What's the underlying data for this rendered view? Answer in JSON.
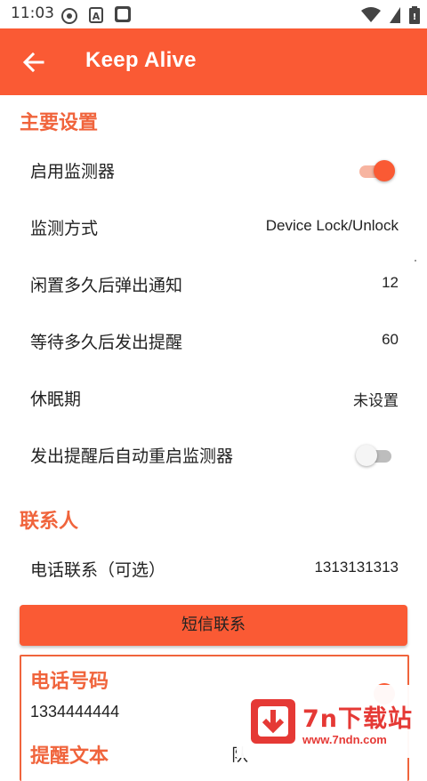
{
  "status_bar": {
    "time": "11:03",
    "icons": [
      "sync-icon",
      "text-a-icon",
      "white-square-icon",
      "wifi-icon",
      "battery-icon"
    ]
  },
  "app_bar": {
    "title": "Keep Alive",
    "background": "#FA5A34",
    "back_icon": "arrow-left-icon"
  },
  "main_section": {
    "title": "主要设置",
    "items": [
      {
        "label": "启用监测器",
        "type": "toggle",
        "on": true
      },
      {
        "label": "监测方式",
        "type": "value",
        "value": "Device Lock/Unlock"
      },
      {
        "label": "闲置多久后弹出通知",
        "type": "value",
        "value": "12"
      },
      {
        "label": "等待多久后发出提醒",
        "type": "value",
        "value": "60"
      },
      {
        "label": "休眠期",
        "type": "value",
        "value": "未设置"
      },
      {
        "label": "发出提醒后自动重启监测器",
        "type": "toggle",
        "on": false
      }
    ]
  },
  "contacts_section": {
    "title": "联系人",
    "phone_contact": {
      "label": "电话联系（可选）",
      "value": "1313131313"
    },
    "sms_button_label": "短信联系",
    "card": {
      "phone_title": "电话号码",
      "phone_number": "1334444444",
      "reminder_title": "提醒文本",
      "reminder_text_partial": "队"
    }
  },
  "watermark": {
    "brand": "7n下载站",
    "url": "www.7ndn.com",
    "icon": "download-arrow-icon",
    "color": "#E53935"
  },
  "colors": {
    "accent": "#FA5A34",
    "section_title": "#F0643C"
  }
}
